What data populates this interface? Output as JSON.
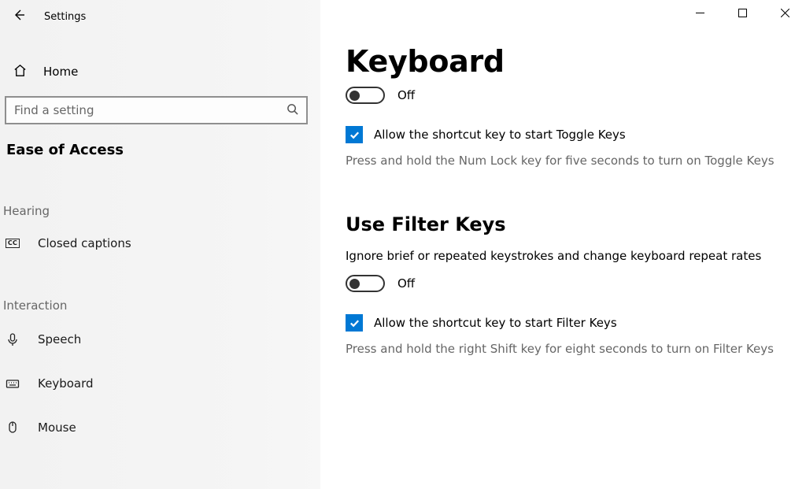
{
  "window": {
    "title": "Settings"
  },
  "sidebar": {
    "home": "Home",
    "search_placeholder": "Find a setting",
    "category": "Ease of Access",
    "groups": [
      {
        "label": "Hearing",
        "items": [
          {
            "label": "Closed captions"
          }
        ]
      },
      {
        "label": "Interaction",
        "items": [
          {
            "label": "Speech"
          },
          {
            "label": "Keyboard"
          },
          {
            "label": "Mouse"
          }
        ]
      }
    ]
  },
  "main": {
    "title": "Keyboard",
    "toggle1": {
      "state": "Off",
      "checked": false
    },
    "check1": {
      "checked": true,
      "label": "Allow the shortcut key to start Toggle Keys",
      "hint": "Press and hold the Num Lock key for five seconds to turn on Toggle Keys"
    },
    "section2": {
      "title": "Use Filter Keys",
      "desc": "Ignore brief or repeated keystrokes and change keyboard repeat rates"
    },
    "toggle2": {
      "state": "Off",
      "checked": false
    },
    "check2": {
      "checked": true,
      "label": "Allow the shortcut key to start Filter Keys",
      "hint": "Press and hold the right Shift key for eight seconds to turn on Filter Keys"
    }
  }
}
